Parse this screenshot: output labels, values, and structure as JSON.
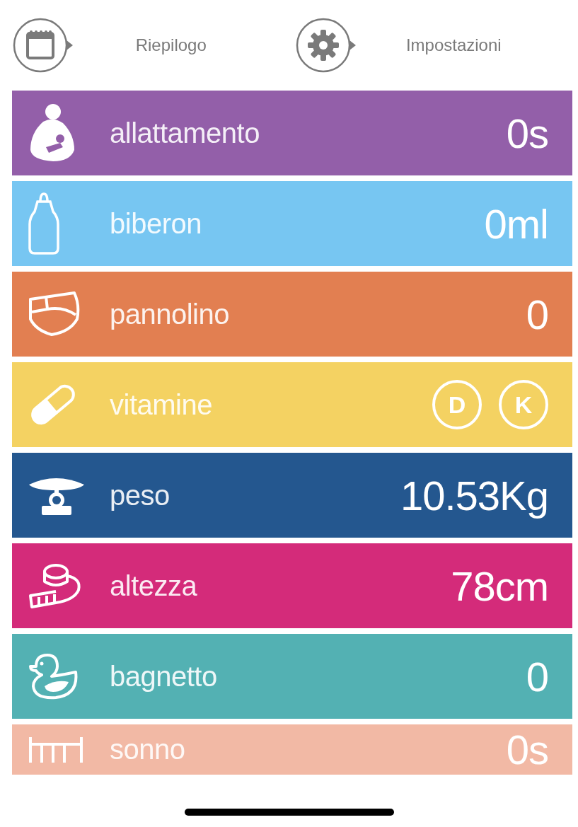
{
  "header": {
    "buttons": [
      {
        "label": "Riepilogo"
      },
      {
        "label": "Impostazioni"
      }
    ]
  },
  "rows": [
    {
      "label": "allattamento",
      "kind": "value",
      "value": "0s",
      "color": "#935fa9"
    },
    {
      "label": "biberon",
      "kind": "value",
      "value": "0ml",
      "color": "#77c6f2"
    },
    {
      "label": "pannolino",
      "kind": "value",
      "value": "0",
      "color": "#e27f51"
    },
    {
      "label": "vitamine",
      "kind": "badges",
      "badges": [
        "D",
        "K"
      ],
      "color": "#f4d262"
    },
    {
      "label": "peso",
      "kind": "value",
      "value": "10.53Kg",
      "color": "#24578f"
    },
    {
      "label": "altezza",
      "kind": "value",
      "value": "78cm",
      "color": "#d42b7a"
    },
    {
      "label": "bagnetto",
      "kind": "value",
      "value": "0",
      "color": "#53b1b3"
    },
    {
      "label": "sonno",
      "kind": "value",
      "value": "0s",
      "color": "#f2b9a5"
    }
  ]
}
